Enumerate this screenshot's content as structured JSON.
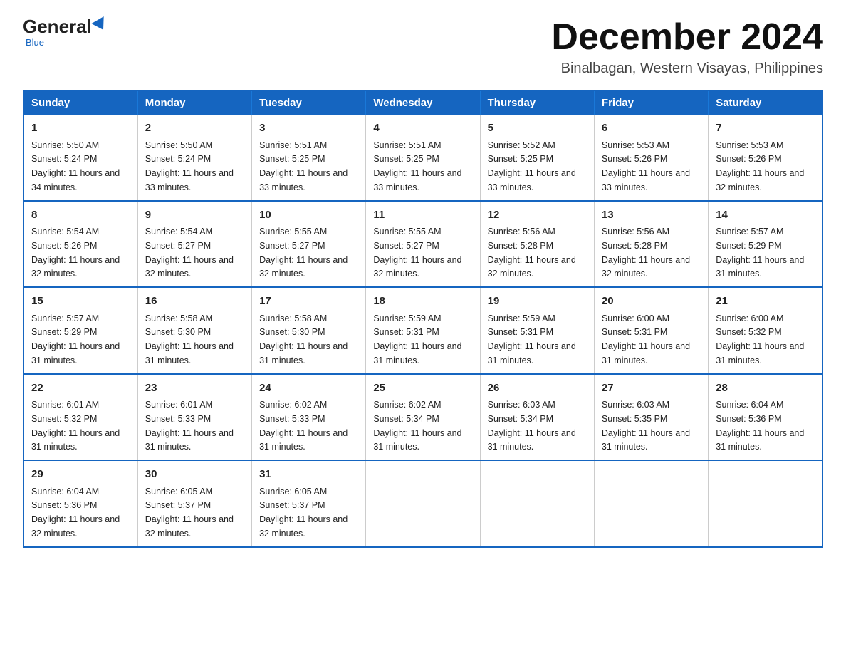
{
  "logo": {
    "general": "General",
    "blue": "Blue"
  },
  "header": {
    "month_year": "December 2024",
    "location": "Binalbagan, Western Visayas, Philippines"
  },
  "days_of_week": [
    "Sunday",
    "Monday",
    "Tuesday",
    "Wednesday",
    "Thursday",
    "Friday",
    "Saturday"
  ],
  "weeks": [
    [
      {
        "day": "1",
        "sunrise": "5:50 AM",
        "sunset": "5:24 PM",
        "daylight": "11 hours and 34 minutes."
      },
      {
        "day": "2",
        "sunrise": "5:50 AM",
        "sunset": "5:24 PM",
        "daylight": "11 hours and 33 minutes."
      },
      {
        "day": "3",
        "sunrise": "5:51 AM",
        "sunset": "5:25 PM",
        "daylight": "11 hours and 33 minutes."
      },
      {
        "day": "4",
        "sunrise": "5:51 AM",
        "sunset": "5:25 PM",
        "daylight": "11 hours and 33 minutes."
      },
      {
        "day": "5",
        "sunrise": "5:52 AM",
        "sunset": "5:25 PM",
        "daylight": "11 hours and 33 minutes."
      },
      {
        "day": "6",
        "sunrise": "5:53 AM",
        "sunset": "5:26 PM",
        "daylight": "11 hours and 33 minutes."
      },
      {
        "day": "7",
        "sunrise": "5:53 AM",
        "sunset": "5:26 PM",
        "daylight": "11 hours and 32 minutes."
      }
    ],
    [
      {
        "day": "8",
        "sunrise": "5:54 AM",
        "sunset": "5:26 PM",
        "daylight": "11 hours and 32 minutes."
      },
      {
        "day": "9",
        "sunrise": "5:54 AM",
        "sunset": "5:27 PM",
        "daylight": "11 hours and 32 minutes."
      },
      {
        "day": "10",
        "sunrise": "5:55 AM",
        "sunset": "5:27 PM",
        "daylight": "11 hours and 32 minutes."
      },
      {
        "day": "11",
        "sunrise": "5:55 AM",
        "sunset": "5:27 PM",
        "daylight": "11 hours and 32 minutes."
      },
      {
        "day": "12",
        "sunrise": "5:56 AM",
        "sunset": "5:28 PM",
        "daylight": "11 hours and 32 minutes."
      },
      {
        "day": "13",
        "sunrise": "5:56 AM",
        "sunset": "5:28 PM",
        "daylight": "11 hours and 32 minutes."
      },
      {
        "day": "14",
        "sunrise": "5:57 AM",
        "sunset": "5:29 PM",
        "daylight": "11 hours and 31 minutes."
      }
    ],
    [
      {
        "day": "15",
        "sunrise": "5:57 AM",
        "sunset": "5:29 PM",
        "daylight": "11 hours and 31 minutes."
      },
      {
        "day": "16",
        "sunrise": "5:58 AM",
        "sunset": "5:30 PM",
        "daylight": "11 hours and 31 minutes."
      },
      {
        "day": "17",
        "sunrise": "5:58 AM",
        "sunset": "5:30 PM",
        "daylight": "11 hours and 31 minutes."
      },
      {
        "day": "18",
        "sunrise": "5:59 AM",
        "sunset": "5:31 PM",
        "daylight": "11 hours and 31 minutes."
      },
      {
        "day": "19",
        "sunrise": "5:59 AM",
        "sunset": "5:31 PM",
        "daylight": "11 hours and 31 minutes."
      },
      {
        "day": "20",
        "sunrise": "6:00 AM",
        "sunset": "5:31 PM",
        "daylight": "11 hours and 31 minutes."
      },
      {
        "day": "21",
        "sunrise": "6:00 AM",
        "sunset": "5:32 PM",
        "daylight": "11 hours and 31 minutes."
      }
    ],
    [
      {
        "day": "22",
        "sunrise": "6:01 AM",
        "sunset": "5:32 PM",
        "daylight": "11 hours and 31 minutes."
      },
      {
        "day": "23",
        "sunrise": "6:01 AM",
        "sunset": "5:33 PM",
        "daylight": "11 hours and 31 minutes."
      },
      {
        "day": "24",
        "sunrise": "6:02 AM",
        "sunset": "5:33 PM",
        "daylight": "11 hours and 31 minutes."
      },
      {
        "day": "25",
        "sunrise": "6:02 AM",
        "sunset": "5:34 PM",
        "daylight": "11 hours and 31 minutes."
      },
      {
        "day": "26",
        "sunrise": "6:03 AM",
        "sunset": "5:34 PM",
        "daylight": "11 hours and 31 minutes."
      },
      {
        "day": "27",
        "sunrise": "6:03 AM",
        "sunset": "5:35 PM",
        "daylight": "11 hours and 31 minutes."
      },
      {
        "day": "28",
        "sunrise": "6:04 AM",
        "sunset": "5:36 PM",
        "daylight": "11 hours and 31 minutes."
      }
    ],
    [
      {
        "day": "29",
        "sunrise": "6:04 AM",
        "sunset": "5:36 PM",
        "daylight": "11 hours and 32 minutes."
      },
      {
        "day": "30",
        "sunrise": "6:05 AM",
        "sunset": "5:37 PM",
        "daylight": "11 hours and 32 minutes."
      },
      {
        "day": "31",
        "sunrise": "6:05 AM",
        "sunset": "5:37 PM",
        "daylight": "11 hours and 32 minutes."
      },
      null,
      null,
      null,
      null
    ]
  ]
}
